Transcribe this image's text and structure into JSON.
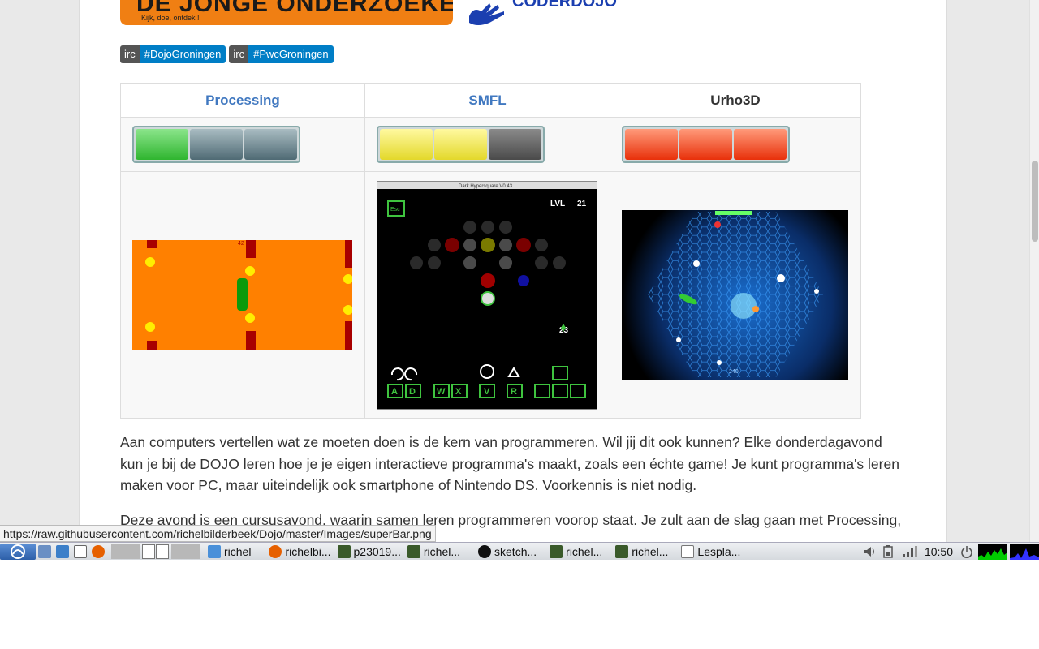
{
  "logos": {
    "left_title": "DE JONGE ONDERZOEKERS",
    "left_tagline": "Kijk, doe, ontdek !",
    "right_title": "CODERDOJO"
  },
  "badges": [
    {
      "key": "irc",
      "value": "#DojoGroningen"
    },
    {
      "key": "irc",
      "value": "#PwcGroningen"
    }
  ],
  "table": {
    "headers": [
      {
        "label": "Processing",
        "link": true
      },
      {
        "label": "SMFL",
        "link": true
      },
      {
        "label": "Urho3D",
        "link": false
      }
    ],
    "difficulty": [
      {
        "filled": 1,
        "of": 3,
        "color": "#2fb52f"
      },
      {
        "filled": 2,
        "of": 3,
        "color": "#e3d82a"
      },
      {
        "filled": 3,
        "of": 3,
        "color": "#e8300a"
      }
    ],
    "shot1": {
      "label": "42"
    },
    "shot2": {
      "title": "Dark Hypersquare V0.43",
      "esc": "Esc",
      "lvl_label": "LVL",
      "lvl_value": "21",
      "moves_value": "23",
      "keys": [
        "A",
        "D",
        "W",
        "X",
        "V",
        "R"
      ]
    },
    "shot3": {
      "label": "240"
    }
  },
  "paragraphs": [
    "Aan computers vertellen wat ze moeten doen is de kern van programmeren. Wil jij dit ook kunnen? Elke donderdagavond kun je bij de DOJO leren hoe je je eigen interactieve programma's maakt, zoals een échte game! Je kunt programma's leren maken voor PC, maar uiteindelijk ook smartphone of Nintendo DS. Voorkennis is niet nodig.",
    "Deze avond is een cursusavond, waarin samen leren programmeren voorop staat. Je zult aan de slag gaan met Processing,"
  ],
  "status_url": "https://raw.githubusercontent.com/richelbilderbeek/Dojo/master/Images/superBar.png",
  "taskbar": {
    "tasks": [
      {
        "label": "richel",
        "icon": "folder-icon",
        "color": "#4a90d9"
      },
      {
        "label": "richelbi...",
        "icon": "firefox-icon",
        "color": "#e66000"
      },
      {
        "label": "p23019...",
        "icon": "terminal-icon",
        "color": "#3a5a2a"
      },
      {
        "label": "richel...",
        "icon": "terminal-icon",
        "color": "#3a5a2a"
      },
      {
        "label": "sketch...",
        "icon": "processing-icon",
        "color": "#111111"
      },
      {
        "label": "richel...",
        "icon": "terminal-icon",
        "color": "#3a5a2a"
      },
      {
        "label": "richel...",
        "icon": "terminal-icon",
        "color": "#3a5a2a"
      },
      {
        "label": "Lespla...",
        "icon": "text-editor-icon",
        "color": "#777777"
      }
    ],
    "clock": "10:50"
  }
}
